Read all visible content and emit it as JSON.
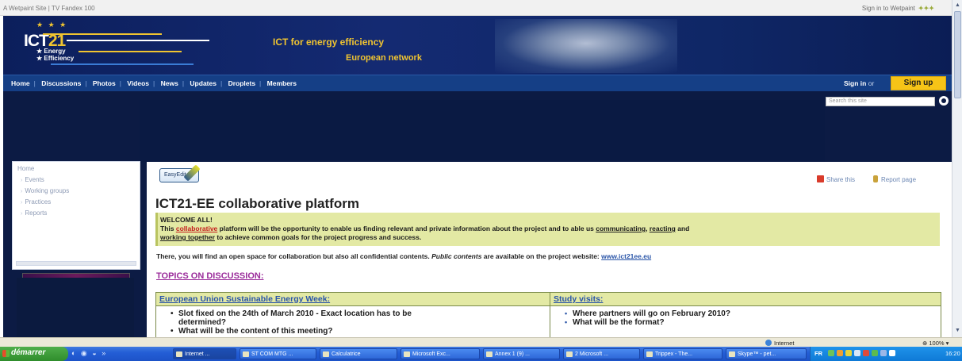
{
  "topbar": {
    "site_label": "A Wetpaint Site | TV Fandex 100",
    "signin_label": "Sign in to Wetpaint",
    "brand": "✦✦✦"
  },
  "banner": {
    "logo_main": "ICT",
    "logo_num": "21",
    "logo_energy": "Energy",
    "logo_efficiency": "Efficiency",
    "tagline1": "ICT for energy efficiency",
    "tagline2": "European network",
    "accent_color": "#f0c430"
  },
  "nav": {
    "items": [
      "Home",
      "Discussions",
      "Photos",
      "Videos",
      "News",
      "Updates",
      "Droplets",
      "Members"
    ],
    "signin": "Sign in",
    "or": "or",
    "signup": "Sign up"
  },
  "search": {
    "placeholder": "Search this site"
  },
  "sidebar": {
    "home": "Home",
    "items": [
      "Events",
      "Working groups",
      "Practices",
      "Reports"
    ]
  },
  "main": {
    "easyedit_label": "EasyEdit",
    "share_label": "Share this",
    "report_label": "Report page",
    "title": "ICT21-EE collaborative platform",
    "welcome": {
      "heading": "WELCOME ALL!",
      "t1": "This ",
      "link1": "collaborative",
      "t2": " platform will be the opportunity to enable us finding relevant and private information about the project and to able us ",
      "link2": "communicating",
      "t3": ", ",
      "link3": "reacting",
      "t4": " and ",
      "link4": "working together",
      "t5": " to achieve common goals for the project progress and success."
    },
    "openspace": {
      "t1": "There, you will find an open space for collaboration but also all confidential contents. ",
      "italic": "Public contents",
      "t2": " are available on the project website: ",
      "link": "www.ict21ee.eu"
    },
    "topics_heading": "TOPICS ON DISCUSSION:",
    "table": {
      "col1": {
        "header": "European Union Sustainable Energy Week:",
        "items": [
          "Slot fixed on the 24th of March 2010 - Exact location has to be",
          "determined?",
          "What will be the content of this meeting?"
        ]
      },
      "col2": {
        "header": "Study visits:",
        "items": [
          "Where partners will go on February 2010?",
          "What will be the format?"
        ]
      }
    }
  },
  "statusbar": {
    "zone": "Internet",
    "zoom": "100%"
  },
  "taskbar": {
    "start": "démarrer",
    "tasks": [
      "Internet ...",
      "ST COM MTG ...",
      "Calculatrice",
      "Microsoft Exc...",
      "Annex 1 (9) ...",
      "2 Microsoft ...",
      "Trippex - The...",
      "Skype™ - pet..."
    ],
    "lang": "FR",
    "clock": "16:20"
  }
}
